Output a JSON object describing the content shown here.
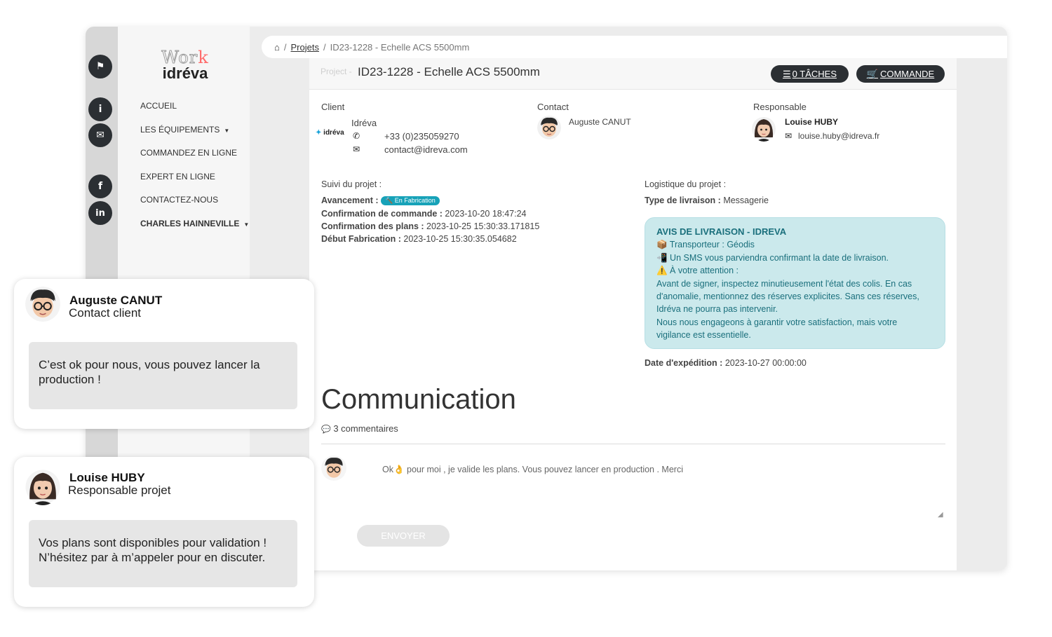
{
  "sidebar": {
    "logo_top": "Work",
    "logo_brand": "idréva",
    "items": [
      {
        "label": "ACCUEIL"
      },
      {
        "label": "LES ÉQUIPEMENTS"
      },
      {
        "label": "COMMANDEZ EN LIGNE"
      },
      {
        "label": "EXPERT EN LIGNE"
      },
      {
        "label": "CONTACTEZ-NOUS"
      },
      {
        "label": "CHARLES HAINNEVILLE"
      }
    ]
  },
  "rail": {
    "icons": [
      "flag-icon",
      "info-icon",
      "envelope-icon",
      "facebook-icon",
      "linkedin-icon"
    ]
  },
  "breadcrumb": {
    "projects": "Projets",
    "current": "ID23-1228 - Echelle ACS 5500mm"
  },
  "project": {
    "label": "Project -",
    "title": "ID23-1228 - Echelle ACS 5500mm",
    "tasks_button": "0 TÂCHES",
    "order_button": "COMMANDE"
  },
  "client": {
    "heading": "Client",
    "name": "Idréva",
    "logo_text": "idréva",
    "phone": "+33 (0)235059270",
    "email": "contact@idreva.com"
  },
  "contact": {
    "heading": "Contact",
    "name": "Auguste CANUT"
  },
  "responsable": {
    "heading": "Responsable",
    "name": "Louise HUBY",
    "email": "louise.huby@idreva.fr"
  },
  "suivi": {
    "heading": "Suivi du projet :",
    "avancement_label": "Avancement :",
    "avancement_badge": "🔨 En Fabrication",
    "confirmation_commande_label": "Confirmation de commande :",
    "confirmation_commande_value": "2023-10-20 18:47:24",
    "confirmation_plans_label": "Confirmation des plans :",
    "confirmation_plans_value": "2023-10-25 15:30:33.171815",
    "debut_fabrication_label": "Début Fabrication :",
    "debut_fabrication_value": "2023-10-25 15:30:35.054682"
  },
  "logistique": {
    "heading": "Logistique du projet :",
    "type_label": "Type de livraison :",
    "type_value": "Messagerie",
    "avis_title": "AVIS DE LIVRAISON - IDREVA",
    "line1": "📦 Transporteur : Géodis",
    "line2": "📲 Un SMS vous parviendra confirmant la date de livraison.",
    "line3": "⚠️ À votre attention :",
    "line4": "Avant de signer, inspectez minutieusement l'état des colis. En cas d'anomalie, mentionnez des réserves explicites. Sans ces réserves, Idréva ne pourra pas intervenir.",
    "line5": "Nous nous engageons à garantir votre satisfaction, mais votre vigilance est essentielle.",
    "expedition_label": "Date d'expédition :",
    "expedition_value": "2023-10-27 00:00:00"
  },
  "communication": {
    "title": "Communication",
    "count": "3 commentaires",
    "comment_text": "Ok👌 pour moi , je valide les plans. Vous pouvez lancer en production . Merci",
    "send_button": "ENVOYER"
  },
  "chat_cards": [
    {
      "name": "Auguste CANUT",
      "role": "Contact client",
      "message": "C’est ok pour nous, vous pouvez lancer la production !"
    },
    {
      "name": "Louise HUBY",
      "role": "Responsable projet",
      "message": "Vos plans sont disponibles pour validation ! N’hésitez par à m’appeler pour en discuter."
    }
  ]
}
